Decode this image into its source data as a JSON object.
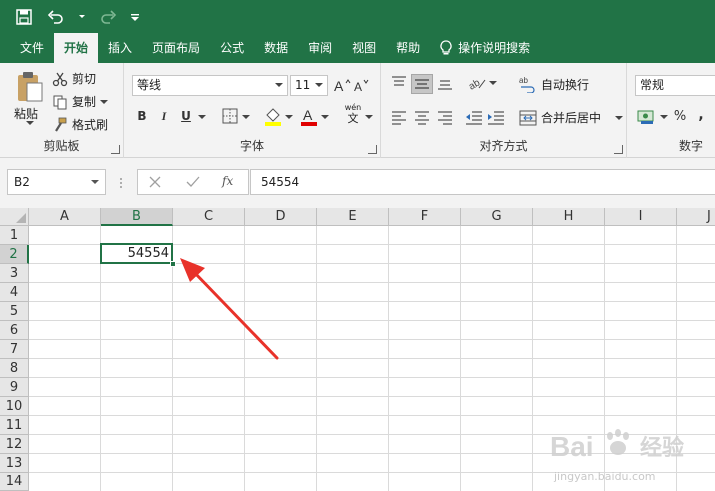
{
  "quick_access": {
    "save_icon": "save-icon",
    "undo_icon": "undo-icon",
    "redo_icon": "redo-icon",
    "customize_icon": "customize-qat-icon"
  },
  "tabs": [
    {
      "label": "文件"
    },
    {
      "label": "开始"
    },
    {
      "label": "插入"
    },
    {
      "label": "页面布局"
    },
    {
      "label": "公式"
    },
    {
      "label": "数据"
    },
    {
      "label": "审阅"
    },
    {
      "label": "视图"
    },
    {
      "label": "帮助"
    },
    {
      "label": "操作说明搜索"
    }
  ],
  "ribbon": {
    "clipboard": {
      "paste_label": "粘贴",
      "cut_label": "剪切",
      "copy_label": "复制",
      "format_painter_label": "格式刷",
      "group_label": "剪贴板"
    },
    "font": {
      "font_name": "等线",
      "font_size": "11",
      "bold": "B",
      "italic": "I",
      "underline": "U",
      "wen_label": "wén",
      "wen_char": "文",
      "group_label": "字体"
    },
    "alignment": {
      "wrap_label": "自动换行",
      "merge_label": "合并后居中",
      "group_label": "对齐方式"
    },
    "number": {
      "format_value": "常规",
      "percent": "%",
      "comma": ",",
      "group_label": "数字"
    }
  },
  "formula_bar": {
    "name_box": "B2",
    "fx_label": "fx",
    "formula_value": "54554"
  },
  "grid": {
    "columns": [
      "A",
      "B",
      "C",
      "D",
      "E",
      "F",
      "G",
      "H",
      "I",
      "J"
    ],
    "rows": [
      "1",
      "2",
      "3",
      "4",
      "5",
      "6",
      "7",
      "8",
      "9",
      "10",
      "11",
      "12",
      "13",
      "14"
    ],
    "selected_cell_value": "54554"
  },
  "colors": {
    "accent": "#217346",
    "arrow": "#e8322a"
  },
  "watermark": {
    "brand": "Bai",
    "brand2": "经验",
    "url": "jingyan.baidu.com"
  }
}
